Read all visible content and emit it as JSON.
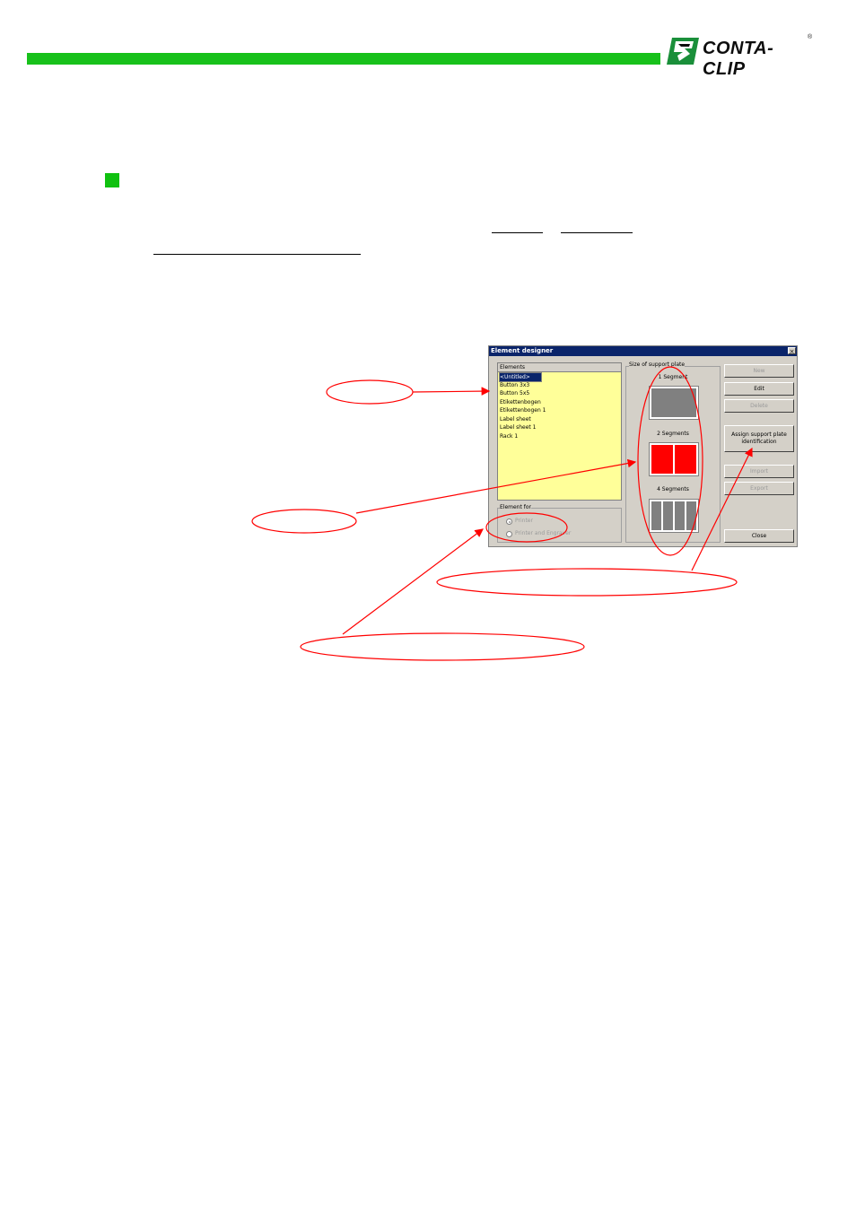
{
  "header": {
    "logo_text": "CONTA-CLIP",
    "logo_reg": "®",
    "bar_color": "#18c11b"
  },
  "dialog": {
    "title": "Element designer",
    "close_glyph": "×",
    "elements_header": "Elements",
    "elements": [
      "<Untitled>",
      "Button 3x3",
      "Button 5x5",
      "Etikettenbogen",
      "Etikettenbogen 1",
      "Label sheet",
      "Label sheet 1",
      "Rack 1"
    ],
    "selected_index": 0,
    "element_for": {
      "label": "Element for",
      "options": [
        "Printer",
        "Printer and Engraver"
      ],
      "selected": "Printer"
    },
    "support_plate": {
      "label": "Size of support plate",
      "segments": [
        {
          "label": "1 Segment",
          "count": 1,
          "color": "#808080"
        },
        {
          "label": "2 Segments",
          "count": 2,
          "color": "#ff0000"
        },
        {
          "label": "4 Segments",
          "count": 4,
          "color": "#808080"
        }
      ]
    },
    "buttons": {
      "new": "New",
      "edit": "Edit",
      "delete": "Delete",
      "assign": "Assign support plate identification",
      "import": "Import",
      "export": "Export",
      "close": "Close"
    }
  },
  "annotation_color": "#ff0000"
}
